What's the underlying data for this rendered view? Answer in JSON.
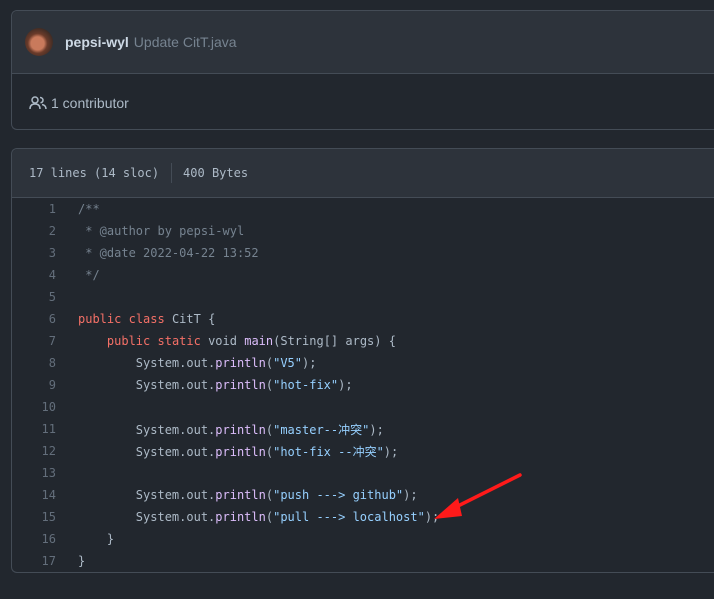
{
  "commit": {
    "author": "pepsi-wyl",
    "message": "Update CitT.java"
  },
  "contributors": {
    "label": "1 contributor"
  },
  "file": {
    "lines_info": "17 lines (14 sloc)",
    "size": "400 Bytes"
  },
  "code": [
    {
      "n": "1",
      "segs": [
        [
          "cm",
          "/**"
        ]
      ]
    },
    {
      "n": "2",
      "segs": [
        [
          "cm",
          " * @author by pepsi-wyl"
        ]
      ]
    },
    {
      "n": "3",
      "segs": [
        [
          "cm",
          " * @date 2022-04-22 13:52"
        ]
      ]
    },
    {
      "n": "4",
      "segs": [
        [
          "cm",
          " */"
        ]
      ]
    },
    {
      "n": "5",
      "segs": []
    },
    {
      "n": "6",
      "segs": [
        [
          "kw",
          "public"
        ],
        [
          "lc",
          " "
        ],
        [
          "kw",
          "class"
        ],
        [
          "lc",
          " CitT {"
        ]
      ]
    },
    {
      "n": "7",
      "segs": [
        [
          "lc",
          "    "
        ],
        [
          "kw",
          "public"
        ],
        [
          "lc",
          " "
        ],
        [
          "kw",
          "static"
        ],
        [
          "lc",
          " void "
        ],
        [
          "fn",
          "main"
        ],
        [
          "lc",
          "(String[] args) {"
        ]
      ]
    },
    {
      "n": "8",
      "segs": [
        [
          "lc",
          "        System.out."
        ],
        [
          "fn",
          "println"
        ],
        [
          "lc",
          "("
        ],
        [
          "st",
          "\"V5\""
        ],
        [
          "lc",
          ");"
        ]
      ]
    },
    {
      "n": "9",
      "segs": [
        [
          "lc",
          "        System.out."
        ],
        [
          "fn",
          "println"
        ],
        [
          "lc",
          "("
        ],
        [
          "st",
          "\"hot-fix\""
        ],
        [
          "lc",
          ");"
        ]
      ]
    },
    {
      "n": "10",
      "segs": []
    },
    {
      "n": "11",
      "segs": [
        [
          "lc",
          "        System.out."
        ],
        [
          "fn",
          "println"
        ],
        [
          "lc",
          "("
        ],
        [
          "st",
          "\"master--冲突\""
        ],
        [
          "lc",
          ");"
        ]
      ]
    },
    {
      "n": "12",
      "segs": [
        [
          "lc",
          "        System.out."
        ],
        [
          "fn",
          "println"
        ],
        [
          "lc",
          "("
        ],
        [
          "st",
          "\"hot-fix --冲突\""
        ],
        [
          "lc",
          ");"
        ]
      ]
    },
    {
      "n": "13",
      "segs": []
    },
    {
      "n": "14",
      "segs": [
        [
          "lc",
          "        System.out."
        ],
        [
          "fn",
          "println"
        ],
        [
          "lc",
          "("
        ],
        [
          "st",
          "\"push ---> github\""
        ],
        [
          "lc",
          ");"
        ]
      ]
    },
    {
      "n": "15",
      "segs": [
        [
          "lc",
          "        System.out."
        ],
        [
          "fn",
          "println"
        ],
        [
          "lc",
          "("
        ],
        [
          "st",
          "\"pull ---> localhost\""
        ],
        [
          "lc",
          ");"
        ]
      ]
    },
    {
      "n": "16",
      "segs": [
        [
          "lc",
          "    }"
        ]
      ]
    },
    {
      "n": "17",
      "segs": [
        [
          "lc",
          "}"
        ]
      ]
    }
  ],
  "colors": {
    "keyword": "#f47067",
    "function": "#dcbdfb",
    "string": "#96d0ff",
    "comment": "#768390",
    "annotation_arrow": "#ff1a1a"
  }
}
